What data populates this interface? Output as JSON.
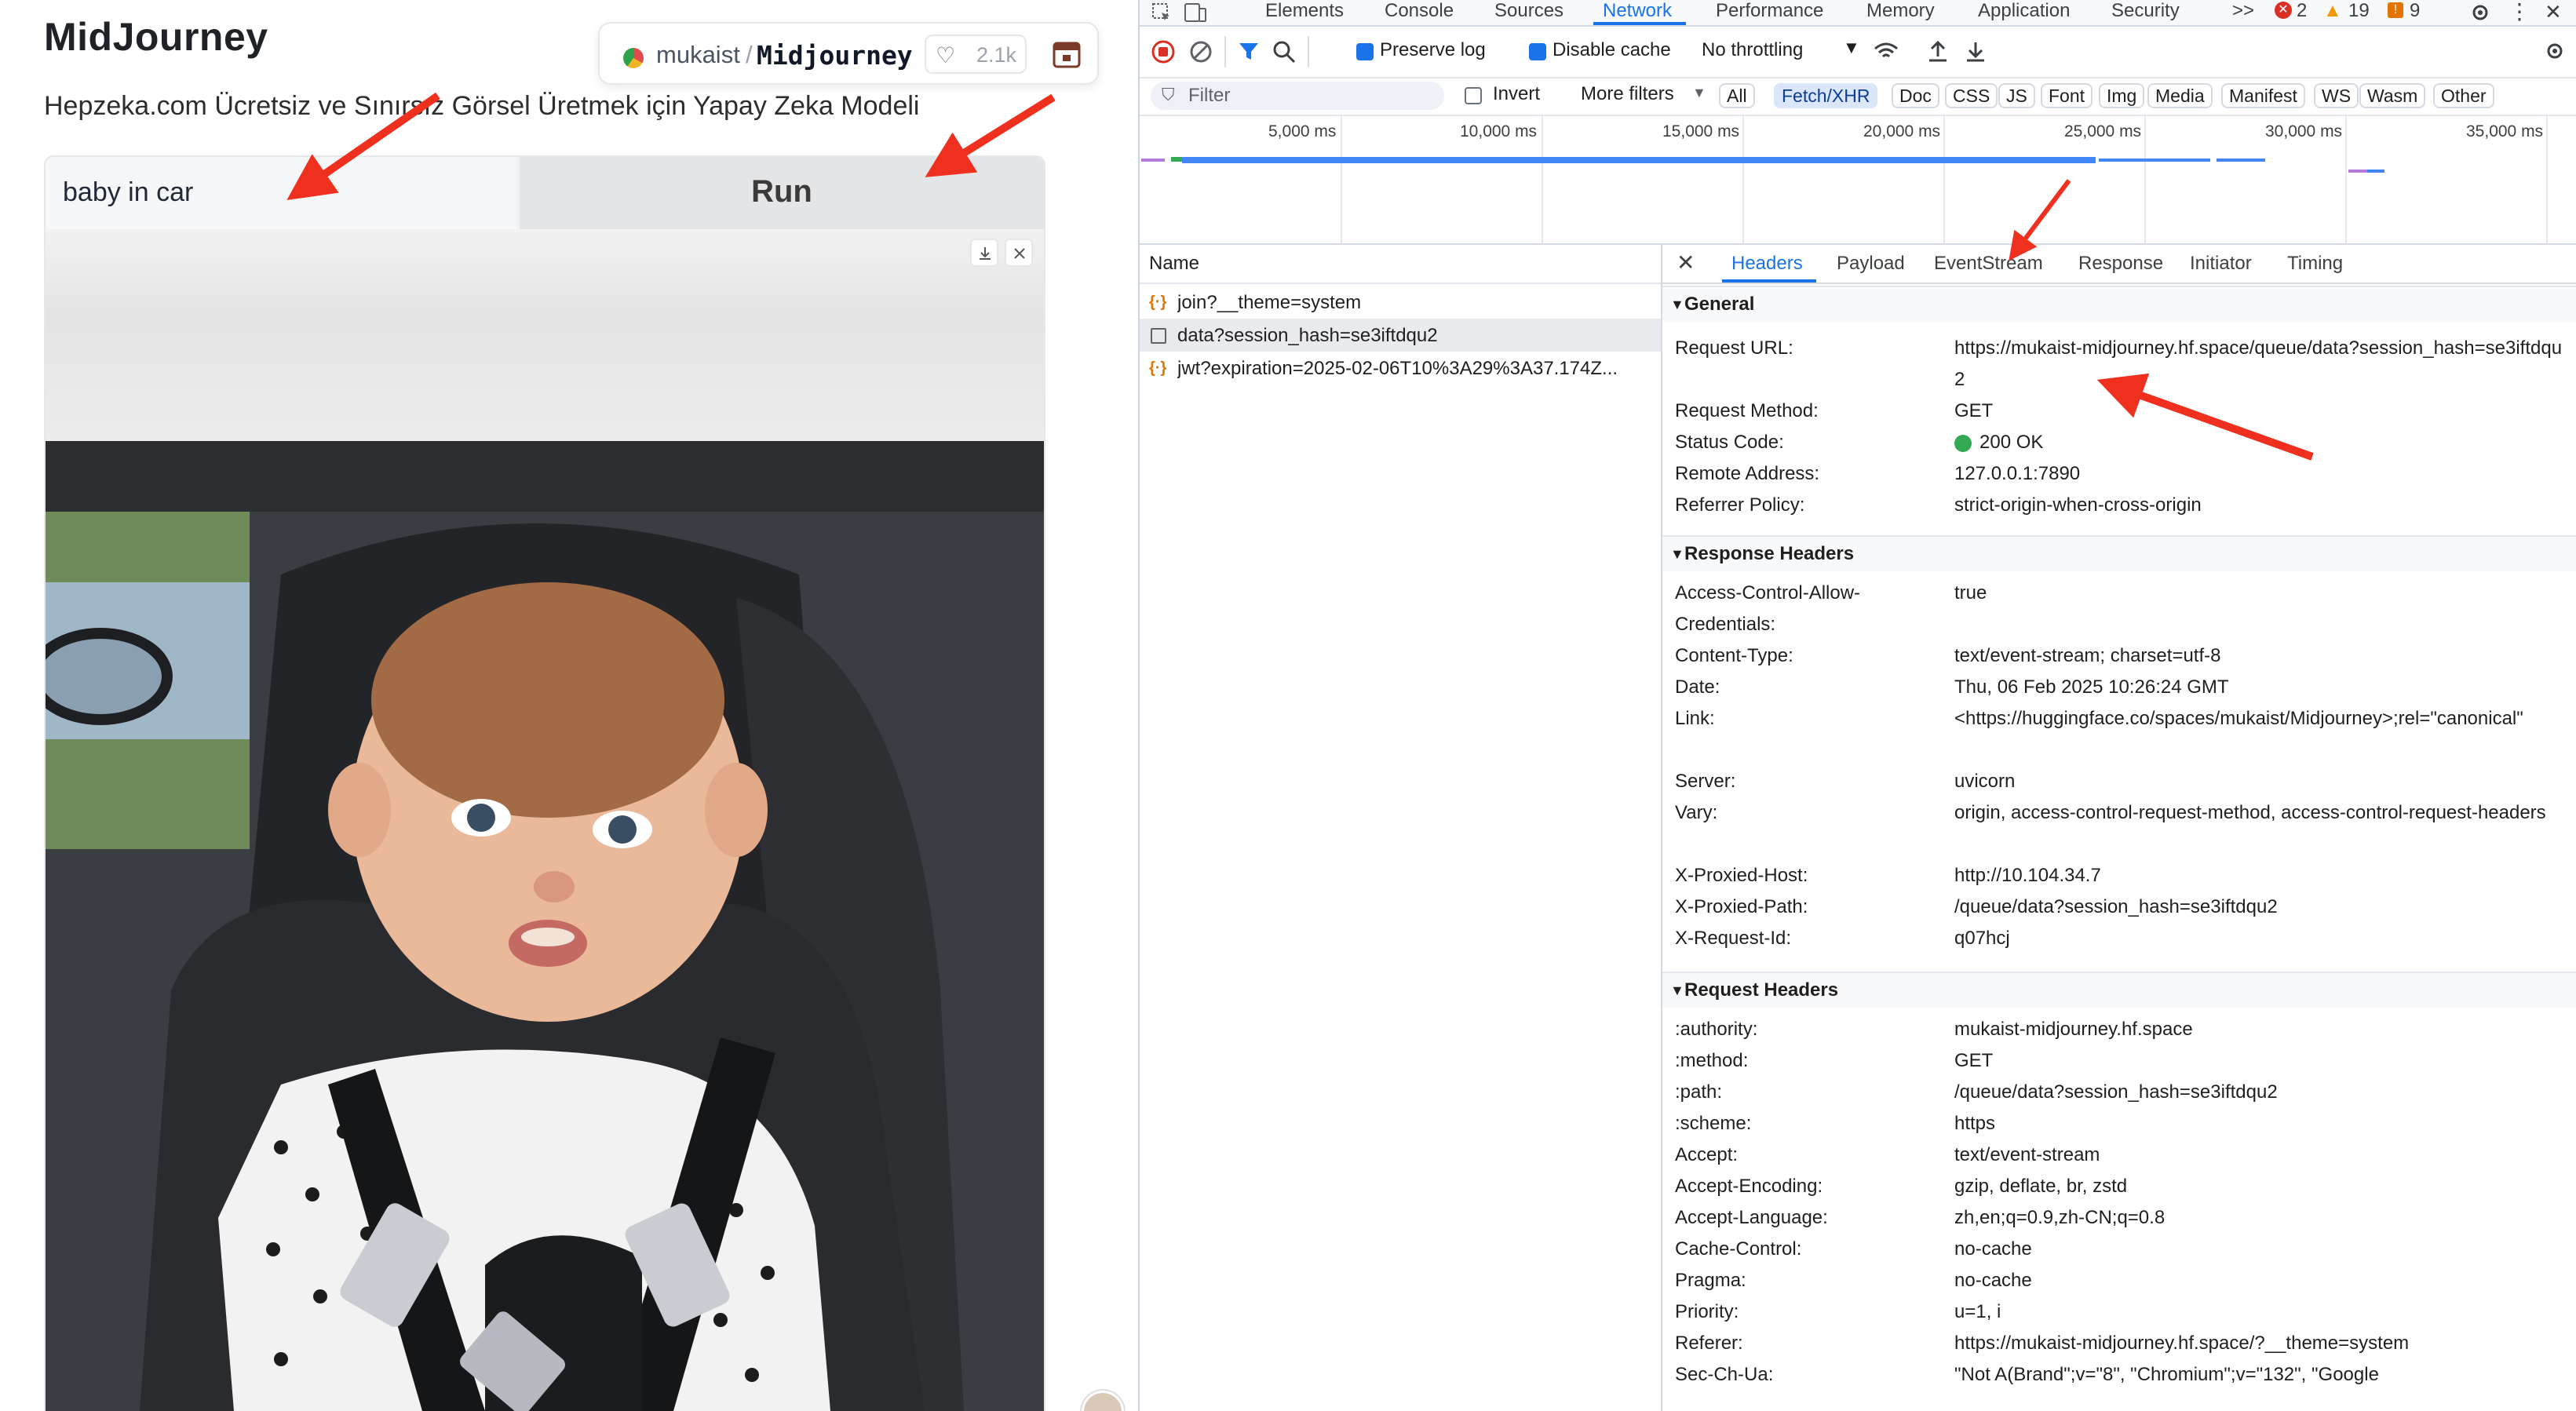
{
  "app": {
    "title": "MidJourney",
    "subtitle": "Hepzeka.com Ücretsiz ve Sınırsız Görsel Üretmek için Yapay Zeka Modeli",
    "badge": {
      "owner": "mukaist",
      "separator": "/",
      "repo": "Midjourney",
      "likes": "2.1k"
    },
    "prompt_value": "baby in car",
    "run_label": "Run",
    "image_alt": "generated image"
  },
  "devtools": {
    "tabs": [
      "Elements",
      "Console",
      "Sources",
      "Network",
      "Performance",
      "Memory",
      "Application",
      "Security"
    ],
    "active_tab": "Network",
    "more_tabs": ">>",
    "error_count": "2",
    "warning_count": "19",
    "info_count": "9",
    "toolbar": {
      "preserve_log": "Preserve log",
      "disable_cache": "Disable cache",
      "throttling": "No throttling"
    },
    "filter": {
      "placeholder": "Filter",
      "invert": "Invert",
      "more_filters": "More filters",
      "chips": [
        "All",
        "Fetch/XHR",
        "Doc",
        "CSS",
        "JS",
        "Font",
        "Img",
        "Media",
        "Manifest",
        "WS",
        "Wasm",
        "Other"
      ],
      "active_chip": "Fetch/XHR"
    },
    "timeline_labels": [
      "5,000 ms",
      "10,000 ms",
      "15,000 ms",
      "20,000 ms",
      "25,000 ms",
      "30,000 ms",
      "35,000 ms"
    ],
    "request_list": {
      "header": "Name",
      "rows": [
        {
          "name": "join?__theme=system"
        },
        {
          "name": "data?session_hash=se3iftdqu2"
        },
        {
          "name": "jwt?expiration=2025-02-06T10%3A29%3A37.174Z..."
        }
      ]
    },
    "detail_tabs": [
      "Headers",
      "Payload",
      "EventStream",
      "Response",
      "Initiator",
      "Timing"
    ],
    "active_detail_tab": "Headers",
    "sections": {
      "general": {
        "title": "General",
        "rows": [
          {
            "key": "Request URL:",
            "value": "https://mukaist-midjourney.hf.space/queue/data?session_hash=se3iftdqu2"
          },
          {
            "key": "Request Method:",
            "value": "GET"
          },
          {
            "key": "Status Code:",
            "value": "200 OK"
          },
          {
            "key": "Remote Address:",
            "value": "127.0.0.1:7890"
          },
          {
            "key": "Referrer Policy:",
            "value": "strict-origin-when-cross-origin"
          }
        ]
      },
      "response": {
        "title": "Response Headers",
        "rows": [
          {
            "key": "Access-Control-Allow-Credentials:",
            "value": "true"
          },
          {
            "key": "Content-Type:",
            "value": "text/event-stream; charset=utf-8"
          },
          {
            "key": "Date:",
            "value": "Thu, 06 Feb 2025 10:26:24 GMT"
          },
          {
            "key": "Link:",
            "value": "<https://huggingface.co/spaces/mukaist/Midjourney>;rel=\"canonical\""
          },
          {
            "key": "Server:",
            "value": "uvicorn"
          },
          {
            "key": "Vary:",
            "value": "origin, access-control-request-method, access-control-request-headers"
          },
          {
            "key": "X-Proxied-Host:",
            "value": "http://10.104.34.7"
          },
          {
            "key": "X-Proxied-Path:",
            "value": "/queue/data?session_hash=se3iftdqu2"
          },
          {
            "key": "X-Request-Id:",
            "value": "q07hcj"
          }
        ]
      },
      "request": {
        "title": "Request Headers",
        "rows": [
          {
            "key": ":authority:",
            "value": "mukaist-midjourney.hf.space"
          },
          {
            "key": ":method:",
            "value": "GET"
          },
          {
            "key": ":path:",
            "value": "/queue/data?session_hash=se3iftdqu2"
          },
          {
            "key": ":scheme:",
            "value": "https"
          },
          {
            "key": "Accept:",
            "value": "text/event-stream"
          },
          {
            "key": "Accept-Encoding:",
            "value": "gzip, deflate, br, zstd"
          },
          {
            "key": "Accept-Language:",
            "value": "zh,en;q=0.9,zh-CN;q=0.8"
          },
          {
            "key": "Cache-Control:",
            "value": "no-cache"
          },
          {
            "key": "Pragma:",
            "value": "no-cache"
          },
          {
            "key": "Priority:",
            "value": "u=1, i"
          },
          {
            "key": "Referer:",
            "value": "https://mukaist-midjourney.hf.space/?__theme=system"
          },
          {
            "key": "Sec-Ch-Ua:",
            "value": "\"Not A(Brand\";v=\"8\", \"Chromium\";v=\"132\", \"Google"
          }
        ]
      }
    }
  },
  "colors": {
    "accent": "#1a73e8",
    "annotation_arrow": "#f0301e",
    "status_ok": "#34a853",
    "error": "#d93025",
    "warning": "#f29900"
  },
  "icons": [
    "inspect-icon",
    "device-toggle-icon",
    "record-stop-icon",
    "clear-icon",
    "filter-icon",
    "search-icon",
    "network-conditions-icon",
    "upload-icon",
    "download-icon",
    "settings-icon",
    "kebab-menu-icon",
    "close-icon",
    "heart-icon",
    "calendar-icon",
    "download-image-icon",
    "close-image-icon"
  ]
}
